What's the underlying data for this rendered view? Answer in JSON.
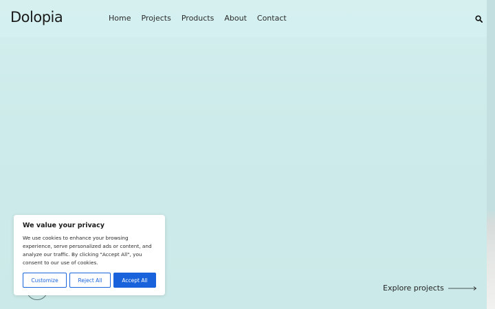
{
  "brand": {
    "logo_text": "Dolopia"
  },
  "nav": {
    "items": [
      {
        "label": "Home"
      },
      {
        "label": "Projects"
      },
      {
        "label": "Products"
      },
      {
        "label": "About"
      },
      {
        "label": "Contact"
      }
    ]
  },
  "hero": {
    "explore_label": "Explore projects"
  },
  "cookie": {
    "title": "We value your privacy",
    "body": "We use cookies to enhance your browsing experience, serve personalized ads or content, and analyze our traffic. By clicking \"Accept All\", you consent to our use of cookies.",
    "customize_label": "Customize",
    "reject_label": "Reject All",
    "accept_label": "Accept All"
  },
  "colors": {
    "accent": "#1863dc",
    "hero_bg": "#cdebea"
  },
  "icons": {
    "search": "search-icon",
    "arrow": "arrow-right-icon"
  }
}
